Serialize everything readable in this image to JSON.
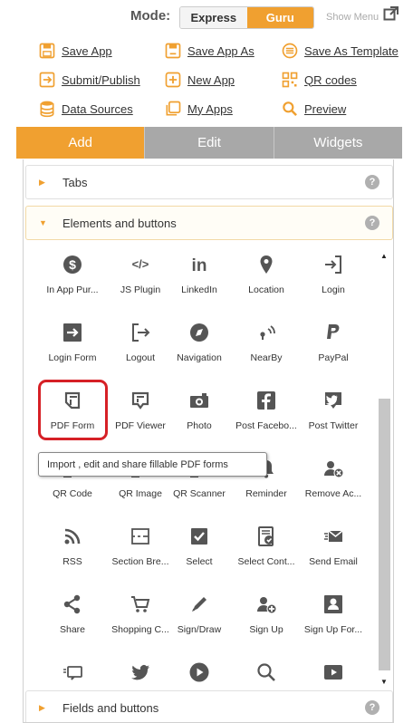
{
  "mode": {
    "label": "Mode:",
    "options": [
      "Express",
      "Guru"
    ],
    "selected": "Guru"
  },
  "show_menu": "Show Menu",
  "menu_links": [
    {
      "label": "Save App",
      "icon": "save-icon"
    },
    {
      "label": "Save App As",
      "icon": "save-as-icon"
    },
    {
      "label": "Save As Template",
      "icon": "template-icon"
    },
    {
      "label": "Submit/Publish",
      "icon": "submit-icon"
    },
    {
      "label": "New App",
      "icon": "new-app-icon"
    },
    {
      "label": "QR codes",
      "icon": "qr-icon"
    },
    {
      "label": "Data Sources",
      "icon": "database-icon"
    },
    {
      "label": "My Apps",
      "icon": "my-apps-icon"
    },
    {
      "label": "Preview",
      "icon": "search-icon"
    }
  ],
  "tabs": [
    {
      "label": "Add",
      "active": true
    },
    {
      "label": "Edit",
      "active": false
    },
    {
      "label": "Widgets",
      "active": false
    }
  ],
  "sections": [
    {
      "title": "Tabs",
      "expanded": false
    },
    {
      "title": "Elements and buttons",
      "expanded": true
    },
    {
      "title": "Fields and buttons",
      "expanded": false
    }
  ],
  "help_glyph": "?",
  "elements": [
    {
      "label": "In App Pur...",
      "icon": "dollar-icon"
    },
    {
      "label": "JS Plugin",
      "icon": "code-icon"
    },
    {
      "label": "LinkedIn",
      "icon": "linkedin-icon"
    },
    {
      "label": "Location",
      "icon": "map-pin-icon"
    },
    {
      "label": "Login",
      "icon": "login-icon"
    },
    {
      "label": "Login Form",
      "icon": "login-form-icon"
    },
    {
      "label": "Logout",
      "icon": "logout-icon"
    },
    {
      "label": "Navigation",
      "icon": "compass-icon"
    },
    {
      "label": "NearBy",
      "icon": "nearby-icon"
    },
    {
      "label": "PayPal",
      "icon": "paypal-icon"
    },
    {
      "label": "PDF Form",
      "icon": "pdf-form-icon"
    },
    {
      "label": "PDF Viewer",
      "icon": "pdf-viewer-icon"
    },
    {
      "label": "Photo",
      "icon": "camera-icon"
    },
    {
      "label": "Post Facebo...",
      "icon": "facebook-icon"
    },
    {
      "label": "Post Twitter",
      "icon": "twitter-post-icon"
    },
    {
      "label": "QR Code",
      "icon": "qr-code-icon"
    },
    {
      "label": "QR Image",
      "icon": "qr-image-icon"
    },
    {
      "label": "QR Scanner",
      "icon": "qr-scanner-icon"
    },
    {
      "label": "Reminder",
      "icon": "bell-icon"
    },
    {
      "label": "Remove Ac...",
      "icon": "remove-account-icon"
    },
    {
      "label": "RSS",
      "icon": "rss-icon"
    },
    {
      "label": "Section Bre...",
      "icon": "section-break-icon"
    },
    {
      "label": "Select",
      "icon": "checkbox-icon"
    },
    {
      "label": "Select Cont...",
      "icon": "select-contact-icon"
    },
    {
      "label": "Send Email",
      "icon": "email-icon"
    },
    {
      "label": "Share",
      "icon": "share-icon"
    },
    {
      "label": "Shopping C...",
      "icon": "cart-icon"
    },
    {
      "label": "Sign/Draw",
      "icon": "pencil-icon"
    },
    {
      "label": "Sign Up",
      "icon": "sign-up-icon"
    },
    {
      "label": "Sign Up For...",
      "icon": "sign-up-form-icon"
    },
    {
      "label": "",
      "icon": "chat-icon"
    },
    {
      "label": "",
      "icon": "twitter-icon"
    },
    {
      "label": "",
      "icon": "play-icon"
    },
    {
      "label": "",
      "icon": "magnifier-icon"
    },
    {
      "label": "",
      "icon": "youtube-icon"
    }
  ],
  "tooltip": "Import , edit and share fillable PDF forms",
  "colors": {
    "accent": "#f0a030",
    "tab_inactive": "#a8a8a8",
    "icon": "#555555",
    "highlight": "#d62026"
  }
}
